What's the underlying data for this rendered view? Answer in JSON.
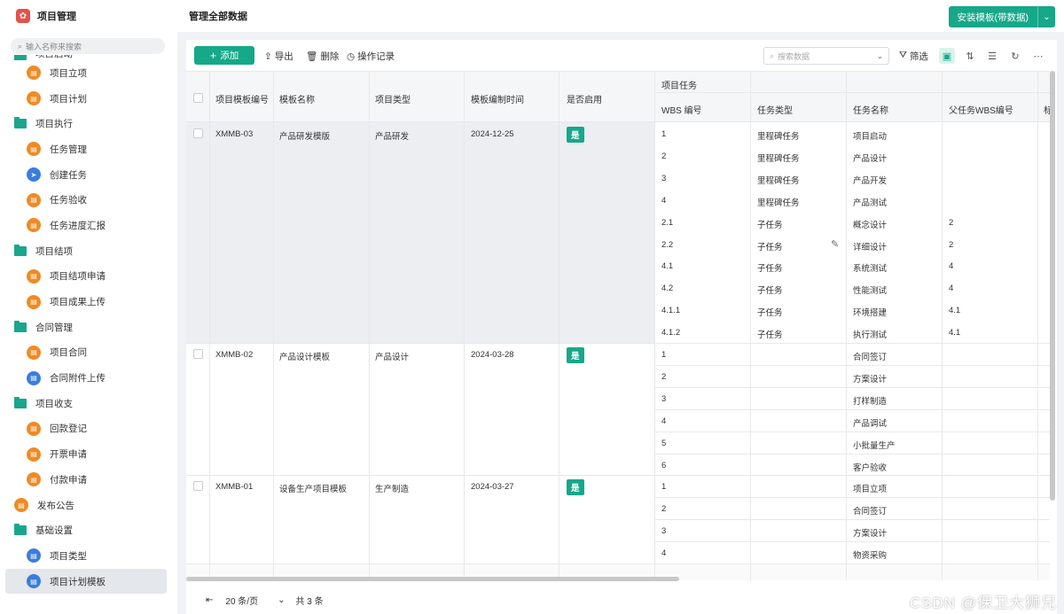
{
  "sidebar": {
    "app_title": "项目管理",
    "search_placeholder": "输入名称来搜索",
    "items": [
      {
        "label": "项目启动",
        "kind": "group"
      },
      {
        "label": "项目立项",
        "kind": "sub",
        "icon": "orange"
      },
      {
        "label": "项目计划",
        "kind": "sub",
        "icon": "orange"
      },
      {
        "label": "项目执行",
        "kind": "group"
      },
      {
        "label": "任务管理",
        "kind": "sub",
        "icon": "orange"
      },
      {
        "label": "创建任务",
        "kind": "sub",
        "icon": "blue"
      },
      {
        "label": "任务验收",
        "kind": "sub",
        "icon": "orange"
      },
      {
        "label": "任务进度汇报",
        "kind": "sub",
        "icon": "orange"
      },
      {
        "label": "项目结项",
        "kind": "group"
      },
      {
        "label": "项目结项申请",
        "kind": "sub",
        "icon": "orange"
      },
      {
        "label": "项目成果上传",
        "kind": "sub",
        "icon": "orange"
      },
      {
        "label": "合同管理",
        "kind": "group"
      },
      {
        "label": "项目合同",
        "kind": "sub",
        "icon": "orange"
      },
      {
        "label": "合同附件上传",
        "kind": "sub",
        "icon": "blue"
      },
      {
        "label": "项目收支",
        "kind": "group"
      },
      {
        "label": "回款登记",
        "kind": "sub",
        "icon": "orange"
      },
      {
        "label": "开票申请",
        "kind": "sub",
        "icon": "orange"
      },
      {
        "label": "付款申请",
        "kind": "sub",
        "icon": "orange"
      },
      {
        "label": "发布公告",
        "kind": "top",
        "icon": "orange"
      },
      {
        "label": "基础设置",
        "kind": "group"
      },
      {
        "label": "项目类型",
        "kind": "sub",
        "icon": "blue"
      },
      {
        "label": "项目计划模板",
        "kind": "sub",
        "icon": "blue",
        "active": true
      }
    ]
  },
  "header": {
    "page_title": "管理全部数据",
    "install_button": "安装模板(带数据)"
  },
  "toolbar": {
    "add": "添加",
    "export": "导出",
    "delete": "删除",
    "log": "操作记录",
    "search_placeholder": "搜索数据",
    "filter": "筛选"
  },
  "table": {
    "columns": {
      "code": "项目模板编号",
      "name": "模板名称",
      "type": "项目类型",
      "date": "模板编制时间",
      "enabled": "是否启用",
      "tasks_group": "项目任务",
      "wbs": "WBS 编号",
      "task_type": "任务类型",
      "task_name": "任务名称",
      "parent_wbs": "父任务WBS编号",
      "extra": "标"
    },
    "rows": [
      {
        "code": "XMMB-03",
        "name": "产品研发模版",
        "type": "产品研发",
        "date": "2024-12-25",
        "enabled": "是",
        "tasks": [
          {
            "wbs": "1",
            "type": "里程碑任务",
            "name": "项目启动",
            "parent": ""
          },
          {
            "wbs": "2",
            "type": "里程碑任务",
            "name": "产品设计",
            "parent": ""
          },
          {
            "wbs": "3",
            "type": "里程碑任务",
            "name": "产品开发",
            "parent": ""
          },
          {
            "wbs": "4",
            "type": "里程碑任务",
            "name": "产品测试",
            "parent": ""
          },
          {
            "wbs": "2.1",
            "type": "子任务",
            "name": "概念设计",
            "parent": "2"
          },
          {
            "wbs": "2.2",
            "type": "子任务",
            "name": "详细设计",
            "parent": "2"
          },
          {
            "wbs": "4.1",
            "type": "子任务",
            "name": "系统测试",
            "parent": "4"
          },
          {
            "wbs": "4.2",
            "type": "子任务",
            "name": "性能测试",
            "parent": "4"
          },
          {
            "wbs": "4.1.1",
            "type": "子任务",
            "name": "环境搭建",
            "parent": "4.1"
          },
          {
            "wbs": "4.1.2",
            "type": "子任务",
            "name": "执行测试",
            "parent": "4.1"
          }
        ]
      },
      {
        "code": "XMMB-02",
        "name": "产品设计模板",
        "type": "产品设计",
        "date": "2024-03-28",
        "enabled": "是",
        "tasks": [
          {
            "wbs": "1",
            "type": "",
            "name": "合同签订",
            "parent": ""
          },
          {
            "wbs": "2",
            "type": "",
            "name": "方案设计",
            "parent": ""
          },
          {
            "wbs": "3",
            "type": "",
            "name": "打样制造",
            "parent": ""
          },
          {
            "wbs": "4",
            "type": "",
            "name": "产品调试",
            "parent": ""
          },
          {
            "wbs": "5",
            "type": "",
            "name": "小批量生产",
            "parent": ""
          },
          {
            "wbs": "6",
            "type": "",
            "name": "客户验收",
            "parent": ""
          }
        ]
      },
      {
        "code": "XMMB-01",
        "name": "设备生产项目模板",
        "type": "生产制造",
        "date": "2024-03-27",
        "enabled": "是",
        "tasks": [
          {
            "wbs": "1",
            "type": "",
            "name": "项目立项",
            "parent": ""
          },
          {
            "wbs": "2",
            "type": "",
            "name": "合同签订",
            "parent": ""
          },
          {
            "wbs": "3",
            "type": "",
            "name": "方案设计",
            "parent": ""
          },
          {
            "wbs": "4",
            "type": "",
            "name": "物资采购",
            "parent": ""
          }
        ]
      }
    ]
  },
  "footer": {
    "page_size": "20 条/页",
    "total": "共 3 条"
  },
  "watermark": "CSDN @保卫大狮兄",
  "colors": {
    "accent": "#16a889",
    "icon_orange": "#f08a24",
    "icon_blue": "#3b7ddd",
    "logo": "#e8504a"
  }
}
